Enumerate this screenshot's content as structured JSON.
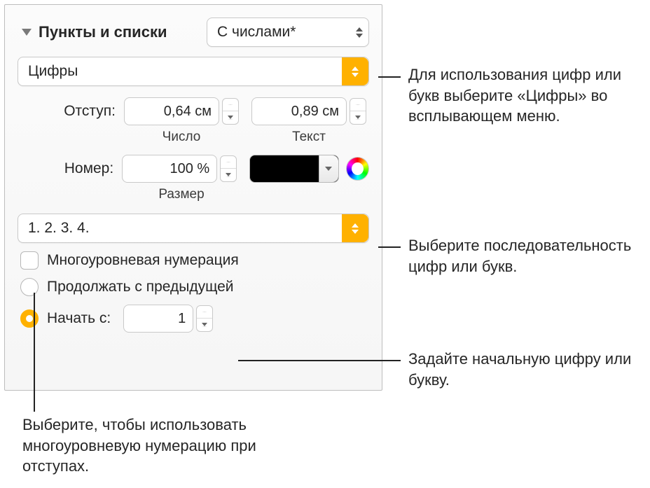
{
  "header": {
    "title": "Пункты и списки",
    "style_popup": "С числами*"
  },
  "type_popup": "Цифры",
  "indent": {
    "label": "Отступ:",
    "number_value": "0,64 см",
    "text_value": "0,89 см",
    "number_caption": "Число",
    "text_caption": "Текст"
  },
  "number": {
    "label": "Номер:",
    "size_value": "100 %",
    "size_caption": "Размер"
  },
  "sequence_popup": "1. 2. 3. 4.",
  "tiered": {
    "label": "Многоуровневая нумерация"
  },
  "continue": {
    "label": "Продолжать с предыдущей"
  },
  "start": {
    "label": "Начать с:",
    "value": "1"
  },
  "callouts": {
    "type": "Для использования цифр или букв выберите «Цифры» во всплывающем меню.",
    "sequence": "Выберите последовательность цифр или букв.",
    "start": "Задайте начальную цифру или букву.",
    "tiered": "Выберите, чтобы использовать многоуровневую нумерацию при отступах."
  }
}
